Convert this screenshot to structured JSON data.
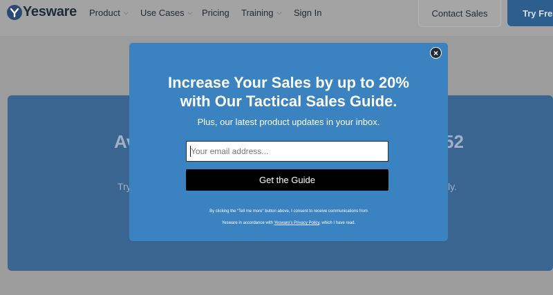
{
  "nav": {
    "logo_text": "Yesware",
    "items": [
      {
        "label": "Product",
        "has_dropdown": true
      },
      {
        "label": "Use Cases",
        "has_dropdown": true
      },
      {
        "label": "Pricing",
        "has_dropdown": false
      },
      {
        "label": "Training",
        "has_dropdown": true
      },
      {
        "label": "Sign In",
        "has_dropdown": false
      }
    ],
    "contact_label": "Contact Sales",
    "try_label": "Try Free"
  },
  "hero": {
    "title_left_fragment": "Av",
    "title_right_fragment": "52",
    "sub_left_fragment": "Try",
    "sub_right_fragment": "ly."
  },
  "modal": {
    "title_line1": "Increase Your Sales by up to 20%",
    "title_line2": "with Our Tactical Sales Guide.",
    "subtitle": "Plus, our latest product updates in your inbox.",
    "email_placeholder": "Your email address...",
    "button_label": "Get the Guide",
    "consent_line1": "By clicking the “Tell me more” button above, I consent to receive communications from",
    "consent_line2_prefix": "Yesware in accordance with ",
    "consent_link": "Yesware's Privacy Policy",
    "consent_line2_suffix": ", which I have read.",
    "close_symbol": "×"
  },
  "colors": {
    "modal_bg": "#3b82c0",
    "button_bg": "#000000",
    "overlay": "#9c9c9c",
    "brand_dark": "#1d2a3d"
  }
}
